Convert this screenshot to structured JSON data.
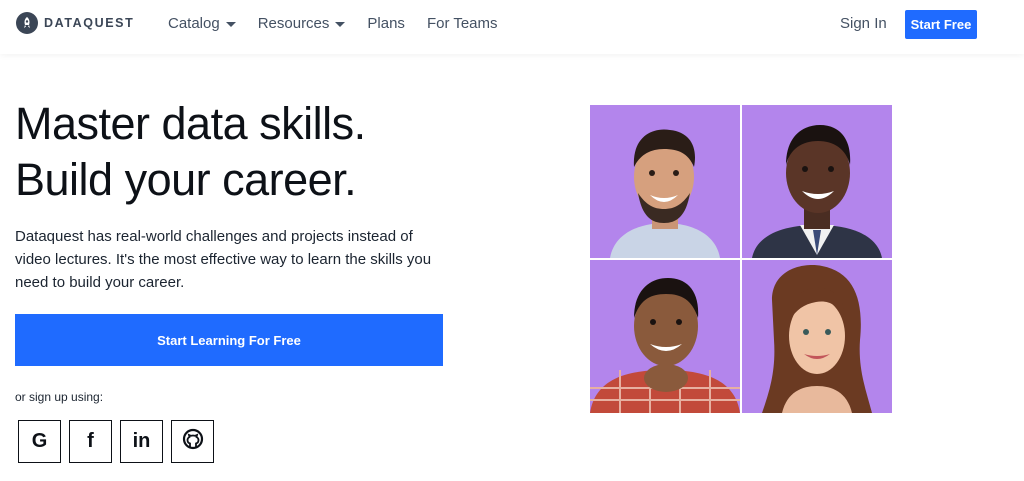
{
  "nav": {
    "logo_text": "DATAQUEST",
    "menu": [
      {
        "label": "Catalog",
        "dropdown": true
      },
      {
        "label": "Resources",
        "dropdown": true
      },
      {
        "label": "Plans",
        "dropdown": false
      },
      {
        "label": "For Teams",
        "dropdown": false
      }
    ],
    "sign_in": "Sign In",
    "start_free": "Start Free"
  },
  "hero": {
    "title_line1": "Master data skills.",
    "title_line2": "Build your career.",
    "subtitle": "Dataquest has real-world challenges and projects instead of video lectures. It's the most effective way to learn the skills you need to build your career.",
    "cta": "Start Learning For Free",
    "signup_label": "or sign up using:",
    "social": [
      {
        "glyph": "G",
        "icon": "google-icon"
      },
      {
        "glyph": "f",
        "icon": "facebook-icon"
      },
      {
        "glyph": "in",
        "icon": "linkedin-icon"
      },
      {
        "glyph": "",
        "icon": "github-icon"
      }
    ]
  },
  "colors": {
    "accent": "#1f6bff",
    "photo_bg": "#b385ec",
    "text": "#0d1117",
    "nav_text": "#445163"
  }
}
